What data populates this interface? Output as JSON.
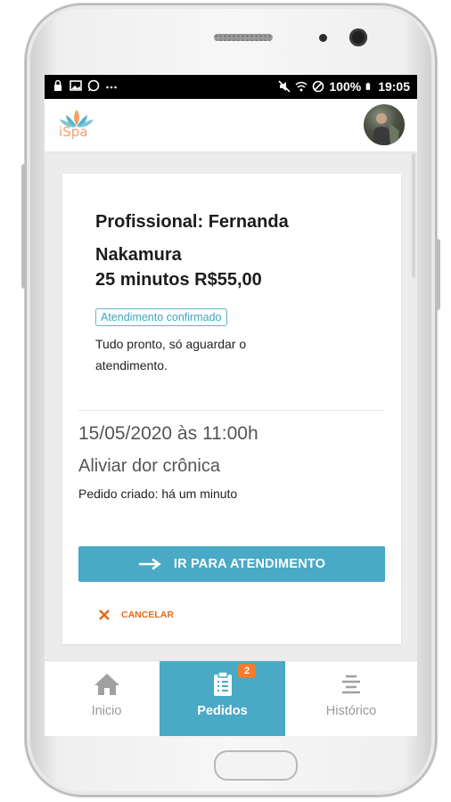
{
  "statusbar": {
    "left_icons": [
      "lock-icon",
      "image-icon",
      "whatsapp-icon",
      "more-icon"
    ],
    "right_icons": [
      "mute-icon",
      "wifi-icon",
      "no-signal-icon",
      "battery-icon"
    ],
    "battery": "100%",
    "time": "19:05"
  },
  "appbar": {
    "logo_text": "iSpa"
  },
  "order": {
    "professional": "Profissional: Fernanda Nakamura",
    "duration_price": "25 minutos R$55,00",
    "status_badge": "Atendimento confirmado",
    "status_message": "Tudo pronto, só aguardar o atendimento.",
    "datetime": "15/05/2020 às 11:00h",
    "service": "Aliviar dor crônica",
    "created": "Pedido criado: há um minuto",
    "primary_action": "IR PARA ATENDIMENTO",
    "cancel_action": "CANCELAR"
  },
  "nav": {
    "items": [
      {
        "label": "Inicio",
        "icon": "home-icon"
      },
      {
        "label": "Pedidos",
        "icon": "clipboard-icon",
        "badge": "2"
      },
      {
        "label": "Histórico",
        "icon": "list-icon"
      }
    ],
    "active": "Pedidos"
  },
  "colors": {
    "accent": "#4aa9c4",
    "orange": "#e36c1d",
    "badge": "#ef7d31"
  }
}
